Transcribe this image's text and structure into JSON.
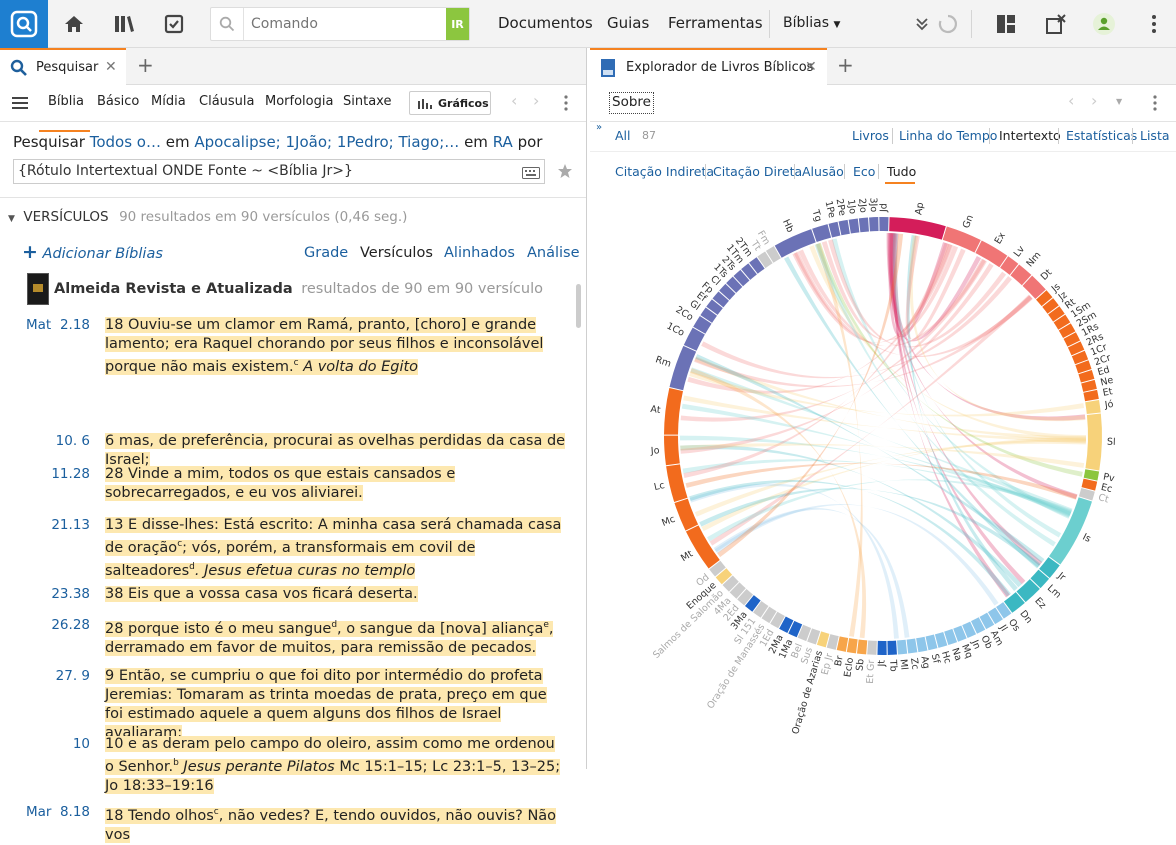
{
  "toolbar": {
    "command_placeholder": "Comando",
    "go_label": "IR",
    "nav": [
      "Documentos",
      "Guias",
      "Ferramentas"
    ],
    "biblias": "Bíblias"
  },
  "left": {
    "tab_title": "Pesquisar",
    "subtabs": [
      "Bíblia",
      "Básico",
      "Mídia",
      "Cláusula",
      "Morfologia",
      "Sintaxe"
    ],
    "graficos": "Gráficos",
    "search_line": {
      "prefix": "Pesquisar",
      "scope": "Todos o…",
      "em": "em",
      "books": "Apocalipse; 1João; 1Pedro; Tiago;…",
      "em2": "em",
      "version": "RA",
      "por": "por"
    },
    "query": "{Rótulo Intertextual ONDE Fonte ~ <Bíblia Jr>}",
    "results_header": "VERSÍCULOS",
    "results_count": "90 resultados em 90 versículos (0,46 seg.)",
    "add_bibles": "Adicionar Bíblias",
    "views": [
      "Grade",
      "Versículos",
      "Alinhados",
      "Análise"
    ],
    "bible_name": "Almeida Revista e Atualizada",
    "bible_results": "resultados de 90 em 90 versículo",
    "verses": [
      {
        "book": "Mat",
        "ref": "2.18",
        "text": "18 Ouviu-se um clamor em Ramá, pranto, [choro] e grande lamento; era Raquel chorando por seus filhos e inconsolável porque não mais existem.",
        "sup": "c",
        "heading": " A volta do Egito"
      },
      {
        "book": "",
        "ref": "10. 6",
        "text": "6 mas, de preferência, procurai as ovelhas perdidas da casa de Israel;",
        "sup": "",
        "heading": ""
      },
      {
        "book": "",
        "ref": "11.28",
        "text": "28 Vinde a mim, todos os que estais cansados e sobrecarregados, e eu vos aliviarei.",
        "sup": "",
        "heading": ""
      },
      {
        "book": "",
        "ref": "21.13",
        "text": "13 E disse-lhes: Está escrito: A minha casa será chamada casa de oração",
        "sup": "c",
        "text2": "; vós, porém, a transformais em covil de salteadores",
        "sup2": "d",
        "heading": ". Jesus efetua curas no templo"
      },
      {
        "book": "",
        "ref": "23.38",
        "text": "38 Eis que a vossa casa vos ficará deserta.",
        "sup": "",
        "heading": ""
      },
      {
        "book": "",
        "ref": "26.28",
        "text": "28 porque isto é o meu sangue",
        "sup": "d",
        "text2": ", o sangue da [nova] aliança",
        "sup2": "e",
        "text3": ", derramado em favor de muitos, para remissão de pecados.",
        "heading": ""
      },
      {
        "book": "",
        "ref": "27. 9",
        "text": "9 Então, se cumpriu o que foi dito por intermédio do profeta Jeremias: Tomaram as trinta moedas de prata, preço em que foi estimado aquele a quem alguns dos filhos de Israel avaliaram;",
        "sup": "",
        "heading": ""
      },
      {
        "book": "",
        "ref": "10",
        "text": "10 e as deram pelo campo do oleiro, assim como me ordenou o Senhor.",
        "sup": "b",
        "heading": " Jesus perante Pilatos",
        "tail": " Mc 15:1–15; Lc 23:1–5, 13–25; Jo 18:33–19:16"
      },
      {
        "book": "Mar",
        "ref": "8.18",
        "text": "18 Tendo olhos",
        "sup": "c",
        "text2": ", não vedes? E, tendo ouvidos, não ouvis? Não vos",
        "heading": ""
      }
    ]
  },
  "right": {
    "tab_title": "Explorador de Livros Bíblicos",
    "sobre": "Sobre",
    "all_label": "All",
    "all_count": "87",
    "views": [
      "Livros",
      "Linha do Tempo",
      "Intertexto",
      "Estatísticas",
      "Lista"
    ],
    "filters": [
      "Citação Indireta",
      "Citação Direta",
      "Alusão",
      "Eco",
      "Tudo"
    ],
    "chord": {
      "segments": [
        {
          "label": "Ap",
          "start": 0,
          "end": 16,
          "color": "#d41d5a"
        },
        {
          "label": "Gn",
          "start": 17,
          "end": 27,
          "color": "#f07575"
        },
        {
          "label": "Ex",
          "start": 28,
          "end": 36,
          "color": "#f07575"
        },
        {
          "label": "Lv",
          "start": 37,
          "end": 40,
          "color": "#f07575"
        },
        {
          "label": "Nm",
          "start": 41,
          "end": 45,
          "color": "#f07575"
        },
        {
          "label": "Dt",
          "start": 46,
          "end": 51,
          "color": "#f07575"
        },
        {
          "label": "Js",
          "start": 52,
          "end": 54,
          "color": "#f26b1d"
        },
        {
          "label": "Jz",
          "start": 55,
          "end": 57,
          "color": "#f26b1d"
        },
        {
          "label": "Rt",
          "start": 58,
          "end": 60,
          "color": "#f26b1d"
        },
        {
          "label": "1Sm",
          "start": 61,
          "end": 63,
          "color": "#f26b1d"
        },
        {
          "label": "2Sm",
          "start": 64,
          "end": 66,
          "color": "#f26b1d"
        },
        {
          "label": "1Rs",
          "start": 67,
          "end": 69,
          "color": "#f26b1d"
        },
        {
          "label": "2Rs",
          "start": 70,
          "end": 72,
          "color": "#f26b1d"
        },
        {
          "label": "1Cr",
          "start": 73,
          "end": 75,
          "color": "#f26b1d"
        },
        {
          "label": "2Cr",
          "start": 76,
          "end": 78,
          "color": "#f26b1d"
        },
        {
          "label": "Ed",
          "start": 79,
          "end": 81,
          "color": "#f26b1d"
        },
        {
          "label": "Ne",
          "start": 82,
          "end": 84,
          "color": "#f26b1d"
        },
        {
          "label": "Et",
          "start": 85,
          "end": 87,
          "color": "#f26b1d"
        },
        {
          "label": "Jó",
          "start": 88,
          "end": 91,
          "color": "#f7d27a"
        },
        {
          "label": "Sl",
          "start": 92,
          "end": 108,
          "color": "#f7d27a"
        },
        {
          "label": "Pv",
          "start": 109,
          "end": 111,
          "color": "#8cc63f"
        },
        {
          "label": "Ec",
          "start": 112,
          "end": 114,
          "color": "#f26b1d"
        },
        {
          "label": "Ct",
          "start": 115,
          "end": 117,
          "color": "#cccccc"
        },
        {
          "label": "Is",
          "start": 118,
          "end": 138,
          "color": "#6ccfcf"
        },
        {
          "label": "Jr",
          "start": 139,
          "end": 143,
          "color": "#3bb8c2"
        },
        {
          "label": "Lm",
          "start": 144,
          "end": 147,
          "color": "#3bb8c2"
        },
        {
          "label": "Ez",
          "start": 148,
          "end": 153,
          "color": "#3bb8c2"
        },
        {
          "label": "Dn",
          "start": 154,
          "end": 158,
          "color": "#3bb8c2"
        },
        {
          "label": "Os",
          "start": 159,
          "end": 161,
          "color": "#8ec6ea"
        },
        {
          "label": "Jl",
          "start": 162,
          "end": 164,
          "color": "#8ec6ea"
        },
        {
          "label": "Am",
          "start": 165,
          "end": 167,
          "color": "#8ec6ea"
        },
        {
          "label": "Ob",
          "start": 168,
          "end": 170,
          "color": "#8ec6ea"
        },
        {
          "label": "Jn",
          "start": 171,
          "end": 173,
          "color": "#8ec6ea"
        },
        {
          "label": "Mq",
          "start": 174,
          "end": 176,
          "color": "#8ec6ea"
        },
        {
          "label": "Na",
          "start": 177,
          "end": 179,
          "color": "#8ec6ea"
        },
        {
          "label": "Hc",
          "start": 180,
          "end": 182,
          "color": "#8ec6ea"
        },
        {
          "label": "Sf",
          "start": 183,
          "end": 185,
          "color": "#8ec6ea"
        },
        {
          "label": "Ag",
          "start": 186,
          "end": 188,
          "color": "#8ec6ea"
        },
        {
          "label": "Zc",
          "start": 189,
          "end": 191,
          "color": "#8ec6ea"
        },
        {
          "label": "Ml",
          "start": 192,
          "end": 194,
          "color": "#8ec6ea"
        },
        {
          "label": "Tb",
          "start": 195,
          "end": 197,
          "color": "#1f64c8"
        },
        {
          "label": "Jt",
          "start": 198,
          "end": 200,
          "color": "#1f64c8"
        },
        {
          "label": "Et Gr",
          "start": 201,
          "end": 203,
          "color": "#cccccc"
        },
        {
          "label": "Sb",
          "start": 204,
          "end": 206,
          "color": "#f7a54a"
        },
        {
          "label": "Eclo",
          "start": 207,
          "end": 209,
          "color": "#f7a54a"
        },
        {
          "label": "Br",
          "start": 210,
          "end": 212,
          "color": "#f7a54a"
        },
        {
          "label": "Ep Jr",
          "start": 213,
          "end": 215,
          "color": "#cccccc"
        },
        {
          "label": "Oração de Azarias",
          "start": 216,
          "end": 218,
          "color": "#f7d27a"
        },
        {
          "label": "Sus",
          "start": 219,
          "end": 221,
          "color": "#cccccc"
        },
        {
          "label": "Bel",
          "start": 222,
          "end": 224,
          "color": "#cccccc"
        },
        {
          "label": "1Ma",
          "start": 225,
          "end": 227,
          "color": "#1f64c8"
        },
        {
          "label": "2Ma",
          "start": 228,
          "end": 230,
          "color": "#1f64c8"
        },
        {
          "label": "1Ed",
          "start": 231,
          "end": 233,
          "color": "#cccccc"
        },
        {
          "label": "Oração de Manassés",
          "start": 234,
          "end": 236,
          "color": "#cccccc"
        },
        {
          "label": "Sl 151",
          "start": 237,
          "end": 239,
          "color": "#cccccc"
        },
        {
          "label": "3Ma",
          "start": 240,
          "end": 242,
          "color": "#1f64c8"
        },
        {
          "label": "2Ed",
          "start": 243,
          "end": 245,
          "color": "#cccccc"
        },
        {
          "label": "4Ma",
          "start": 246,
          "end": 248,
          "color": "#cccccc"
        },
        {
          "label": "Salmos de Salomão",
          "start": 249,
          "end": 251,
          "color": "#cccccc"
        },
        {
          "label": "Enoque",
          "start": 252,
          "end": 254,
          "color": "#f7d27a"
        },
        {
          "label": "Od",
          "start": 255,
          "end": 257,
          "color": "#cccccc"
        },
        {
          "label": "Mt",
          "start": 258,
          "end": 270,
          "color": "#f26b1d"
        },
        {
          "label": "Mc",
          "start": 271,
          "end": 279,
          "color": "#f26b1d"
        },
        {
          "label": "Lc",
          "start": 280,
          "end": 290,
          "color": "#f26b1d"
        },
        {
          "label": "Jo",
          "start": 291,
          "end": 299,
          "color": "#f26b1d"
        },
        {
          "label": "At",
          "start": 300,
          "end": 313,
          "color": "#f26b1d"
        },
        {
          "label": "Rm",
          "start": 314,
          "end": 326,
          "color": "#6b72b6"
        },
        {
          "label": "1Co",
          "start": 327,
          "end": 332,
          "color": "#6b72b6"
        },
        {
          "label": "2Co",
          "start": 333,
          "end": 336,
          "color": "#6b72b6"
        },
        {
          "label": "Gl",
          "start": 337,
          "end": 339,
          "color": "#6b72b6"
        },
        {
          "label": "Ef",
          "start": 340,
          "end": 342,
          "color": "#6b72b6"
        },
        {
          "label": "Fp",
          "start": 343,
          "end": 345,
          "color": "#6b72b6"
        },
        {
          "label": "Cl",
          "start": 346,
          "end": 348,
          "color": "#6b72b6"
        },
        {
          "label": "1Ts",
          "start": 349,
          "end": 351,
          "color": "#6b72b6"
        },
        {
          "label": "2Ts",
          "start": 352,
          "end": 354,
          "color": "#6b72b6"
        },
        {
          "label": "1Tm",
          "start": 355,
          "end": 357,
          "color": "#6b72b6"
        },
        {
          "label": "2Tm",
          "start": 358,
          "end": 360,
          "color": "#6b72b6"
        },
        {
          "label": "Tt",
          "start": 361,
          "end": 363,
          "color": "#cccccc"
        },
        {
          "label": "Fm",
          "start": 364,
          "end": 366,
          "color": "#cccccc"
        },
        {
          "label": "Hb",
          "start": 367,
          "end": 378,
          "color": "#6b72b6"
        },
        {
          "label": "Tg",
          "start": 379,
          "end": 383,
          "color": "#6b72b6"
        },
        {
          "label": "1Pe",
          "start": 384,
          "end": 386,
          "color": "#6b72b6"
        },
        {
          "label": "2Pe",
          "start": 387,
          "end": 389,
          "color": "#6b72b6"
        },
        {
          "label": "1Jo",
          "start": 390,
          "end": 392,
          "color": "#6b72b6"
        },
        {
          "label": "2Jo",
          "start": 393,
          "end": 395,
          "color": "#6b72b6"
        },
        {
          "label": "3Jo",
          "start": 396,
          "end": 398,
          "color": "#6b72b6"
        },
        {
          "label": "Jd",
          "start": 399,
          "end": 401,
          "color": "#6b72b6"
        }
      ],
      "total": 402
    }
  },
  "colors": {
    "accent": "#f58220",
    "link": "#1b5f9e",
    "highlight": "#fde8b0",
    "logo": "#1e7fd0"
  }
}
